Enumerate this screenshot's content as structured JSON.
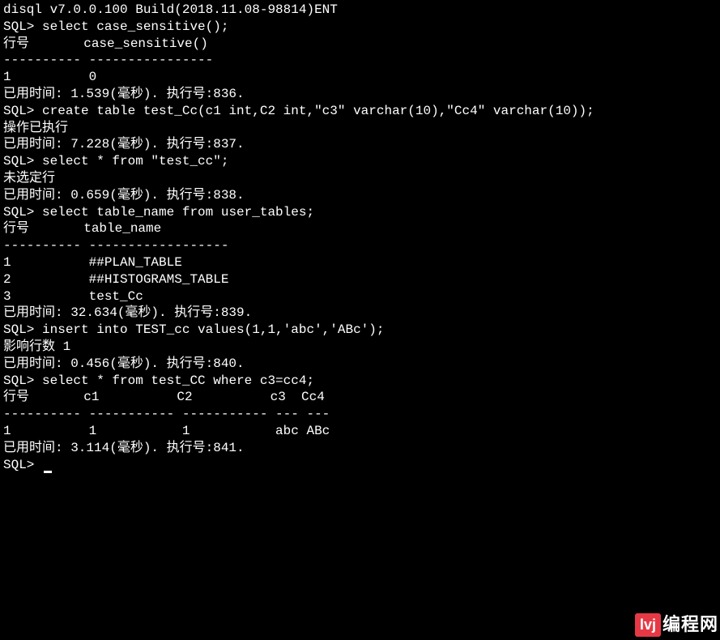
{
  "lines": {
    "l0": "disql v7.0.0.100 Build(2018.11.08-98814)ENT",
    "l1": "SQL> select case_sensitive();",
    "l2": "",
    "l3": "行号       case_sensitive()",
    "l4": "---------- ----------------",
    "l5": "1          0",
    "l6": "",
    "l7": "已用时间: 1.539(毫秒). 执行号:836.",
    "l8": "SQL> create table test_Cc(c1 int,C2 int,\"c3\" varchar(10),\"Cc4\" varchar(10));",
    "l9": "操作已执行",
    "l10": "已用时间: 7.228(毫秒). 执行号:837.",
    "l11": "SQL> select * from \"test_cc\";",
    "l12": "未选定行",
    "l13": "",
    "l14": "已用时间: 0.659(毫秒). 执行号:838.",
    "l15": "SQL> select table_name from user_tables;",
    "l16": "",
    "l17": "行号       table_name",
    "l18": "---------- ------------------",
    "l19": "1          ##PLAN_TABLE",
    "l20": "2          ##HISTOGRAMS_TABLE",
    "l21": "3          test_Cc",
    "l22": "",
    "l23": "已用时间: 32.634(毫秒). 执行号:839.",
    "l24": "SQL> insert into TEST_cc values(1,1,'abc','ABc');",
    "l25": "影响行数 1",
    "l26": "",
    "l27": "已用时间: 0.456(毫秒). 执行号:840.",
    "l28": "SQL> select * from test_CC where c3=cc4;",
    "l29": "",
    "l30": "行号       c1          C2          c3  Cc4",
    "l31": "---------- ----------- ----------- --- ---",
    "l32": "1          1           1           abc ABc",
    "l33": "",
    "l34": "已用时间: 3.114(毫秒). 执行号:841.",
    "l35": "SQL> "
  },
  "watermark": {
    "badge": "lvj",
    "text": "编程网"
  }
}
